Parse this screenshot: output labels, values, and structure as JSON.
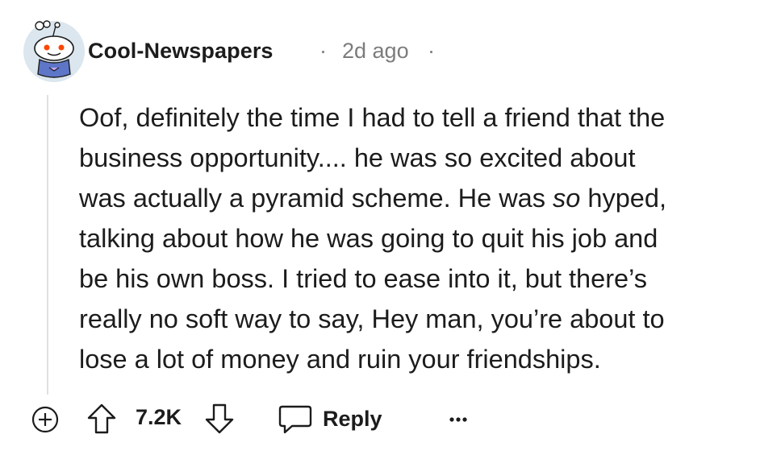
{
  "comment": {
    "author": "Cool-Newspapers",
    "separator": "·",
    "time": "2d ago",
    "body_lines": [
      [
        "Oof, definitely the time I had to tell a friend that the"
      ],
      [
        "business opportunity.... he was so excited about"
      ],
      [
        "was actually a pyramid scheme. He was ",
        "so",
        " hyped,"
      ],
      [
        "talking about how he was going to quit his job and"
      ],
      [
        "be his own boss. I tried to ease into it, but there’s"
      ],
      [
        "really no soft way to say, Hey man, you’re about to"
      ],
      [
        "lose a lot of money and ruin your friendships."
      ]
    ]
  },
  "actions": {
    "score": "7.2K",
    "reply_label": "Reply"
  },
  "icons": {
    "avatar": "snoo-avatar-icon",
    "expand": "plus-circle-icon",
    "upvote": "arrow-up-icon",
    "downvote": "arrow-down-icon",
    "reply": "speech-bubble-icon",
    "more": "ellipsis-icon"
  },
  "colors": {
    "text": "#1c1c1c",
    "meta": "#7c7c7c",
    "thread_line": "#e0e0e0",
    "avatar_bg": "#dbe6ee"
  }
}
